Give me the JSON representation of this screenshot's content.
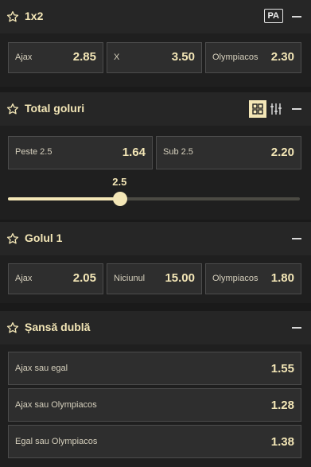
{
  "markets": {
    "m1x2": {
      "title": "1x2",
      "badge": "PA",
      "outcomes": [
        {
          "label": "Ajax",
          "odds": "2.85"
        },
        {
          "label": "X",
          "odds": "3.50"
        },
        {
          "label": "Olympiacos",
          "odds": "2.30"
        }
      ]
    },
    "total": {
      "title": "Total goluri",
      "outcomes": [
        {
          "label": "Peste 2.5",
          "odds": "1.64"
        },
        {
          "label": "Sub 2.5",
          "odds": "2.20"
        }
      ],
      "slider": {
        "value": "2.5",
        "fraction": 0.385
      }
    },
    "golul1": {
      "title": "Golul 1",
      "outcomes": [
        {
          "label": "Ajax",
          "odds": "2.05"
        },
        {
          "label": "Niciunul",
          "odds": "15.00"
        },
        {
          "label": "Olympiacos",
          "odds": "1.80"
        }
      ]
    },
    "sansa": {
      "title": "Șansă dublă",
      "outcomes": [
        {
          "label": "Ajax sau egal",
          "odds": "1.55"
        },
        {
          "label": "Ajax sau Olympiacos",
          "odds": "1.28"
        },
        {
          "label": "Egal sau Olympiacos",
          "odds": "1.38"
        }
      ]
    }
  },
  "colors": {
    "accent": "#f3e6b6",
    "panel": "#2e2e2e",
    "header": "#262626"
  }
}
